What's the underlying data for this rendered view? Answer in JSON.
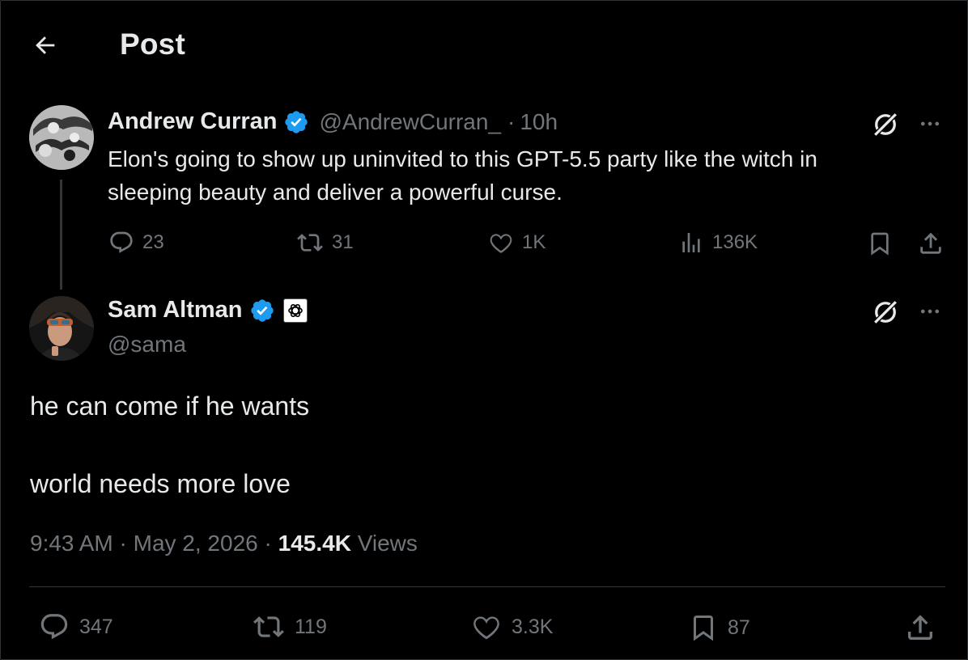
{
  "header": {
    "title": "Post"
  },
  "parent_post": {
    "author_name": "Andrew Curran",
    "handle": "@AndrewCurran_",
    "separator": "·",
    "time": "10h",
    "text_line1": "Elon's going to show up uninvited to this GPT-5.5 party like the witch in",
    "text_line2": "sleeping beauty and deliver a powerful curse.",
    "actions": {
      "replies": "23",
      "reposts": "31",
      "likes": "1K",
      "views": "136K"
    }
  },
  "main_post": {
    "author_name": "Sam Altman",
    "handle": "@sama",
    "text_line1": "he can come if he wants",
    "text_line2": "world needs more love",
    "time": "9:43 AM",
    "date": "May 2, 2026",
    "separator": "·",
    "views_count": "145.4K",
    "views_label": "Views",
    "actions": {
      "replies": "347",
      "reposts": "119",
      "likes": "3.3K",
      "bookmarks": "87"
    }
  },
  "colors": {
    "background": "#000000",
    "text": "#e7e9ea",
    "muted": "#71767b",
    "verified": "#1d9bf0",
    "divider": "#2f3336"
  },
  "icons": [
    "back-arrow-icon",
    "verified-badge-icon",
    "grok-icon",
    "more-icon",
    "reply-icon",
    "repost-icon",
    "like-icon",
    "views-icon",
    "bookmark-icon",
    "share-icon",
    "openai-affiliate-badge-icon"
  ]
}
